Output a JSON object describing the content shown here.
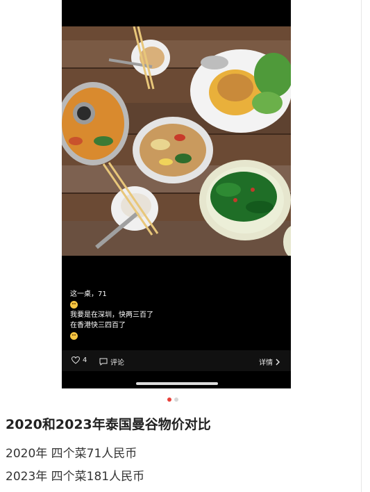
{
  "screenshot": {
    "caption_lines": [
      "这一桌，71",
      "我要是在深圳，快两三百了",
      "在香港快三四百了"
    ],
    "emoji_lines": [
      "grinning-emoji",
      "grinning-emoji"
    ],
    "actions": {
      "like_icon": "heart-outline-icon",
      "like_count": "4",
      "comment_icon": "comment-bubble-icon",
      "comment_label": "评论",
      "details_label": "详情",
      "details_icon": "chevron-right-icon"
    }
  },
  "carousel": {
    "total": 2,
    "active_index": 0,
    "active_color": "#e8413a"
  },
  "post": {
    "title": "2020和2023年泰国曼谷物价对比",
    "lines": [
      "2020年 四个菜71人民币",
      "2023年 四个菜181人民币"
    ]
  }
}
